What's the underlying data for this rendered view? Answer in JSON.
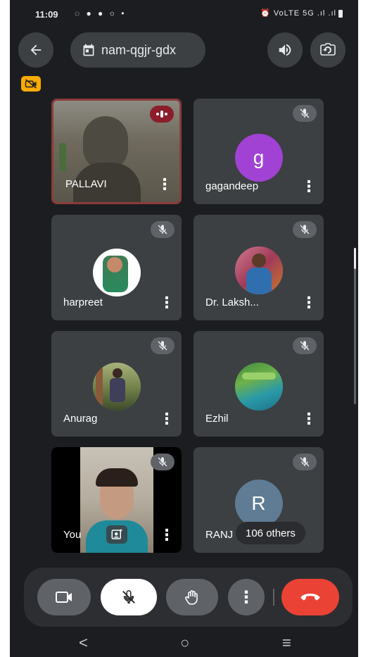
{
  "status_bar": {
    "time": "11:09",
    "notification_icons": "◌ ● ● ○ •",
    "system_icons": "⏰ VoLTE 5G .ıl .ıl"
  },
  "top_bar": {
    "meeting_code": "nam-qgjr-gdx"
  },
  "participants": [
    {
      "name": "PALLAVI",
      "state": "speaking"
    },
    {
      "name": "gagandeep",
      "avatar_letter": "g",
      "avatar_color": "#a142d4"
    },
    {
      "name": "harpreet"
    },
    {
      "name": "Dr. Laksh..."
    },
    {
      "name": "Anurag"
    },
    {
      "name": "Ezhil"
    },
    {
      "name": "You"
    },
    {
      "name": "RANJ",
      "avatar_letter": "R",
      "avatar_color": "#5f7c94",
      "others_label": "106 others"
    }
  ],
  "colors": {
    "background": "#1c1d20",
    "tile": "#3c4043",
    "end_call": "#ea4335",
    "warning": "#f9ab00"
  },
  "nav_bar": {
    "back": "<",
    "home": "○",
    "recents": "≡"
  }
}
